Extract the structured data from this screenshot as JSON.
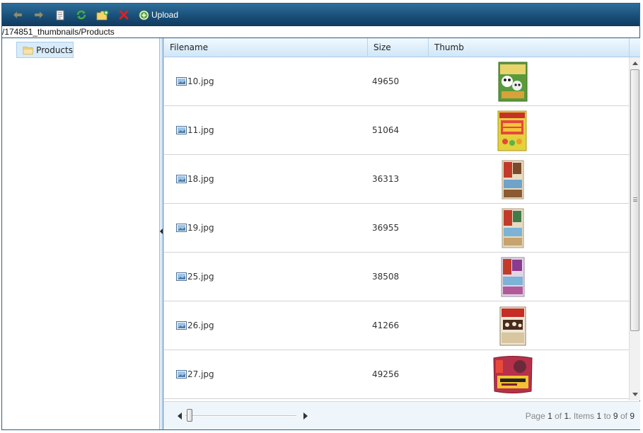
{
  "toolbar": {
    "buttons": [
      {
        "name": "back",
        "icon": "arrow-left-icon"
      },
      {
        "name": "forward",
        "icon": "arrow-right-icon"
      },
      {
        "name": "view",
        "icon": "document-icon"
      },
      {
        "name": "refresh",
        "icon": "refresh-icon"
      },
      {
        "name": "new-folder",
        "icon": "new-folder-icon"
      },
      {
        "name": "delete",
        "icon": "delete-icon"
      }
    ],
    "upload_label": "Upload"
  },
  "path": "/174851_thumbnails/Products",
  "tree": {
    "selected_folder": "Products"
  },
  "grid": {
    "columns": [
      "Filename",
      "Size",
      "Thumb"
    ],
    "rows": [
      {
        "filename": "10.jpg",
        "size": "49650",
        "thumb": "panda cereal box"
      },
      {
        "filename": "11.jpg",
        "size": "51064",
        "thumb": "gummy bears box"
      },
      {
        "filename": "18.jpg",
        "size": "36313",
        "thumb": "clif bar"
      },
      {
        "filename": "19.jpg",
        "size": "36955",
        "thumb": "clif bar"
      },
      {
        "filename": "25.jpg",
        "size": "38508",
        "thumb": "clif bar"
      },
      {
        "filename": "26.jpg",
        "size": "41266",
        "thumb": "clif bar box"
      },
      {
        "filename": "27.jpg",
        "size": "49256",
        "thumb": "clif shot bloks"
      }
    ]
  },
  "pager": {
    "page_word": "Page",
    "page": "1",
    "of_word": "of",
    "total_pages": "1.",
    "items_word": "Items",
    "from": "1",
    "to_word": "to",
    "to": "9",
    "of_word2": "of",
    "total": "9"
  },
  "colors": {
    "toolbar": "#1a4f78",
    "header": "#cfe6f8",
    "selection": "#d7ebfa"
  }
}
